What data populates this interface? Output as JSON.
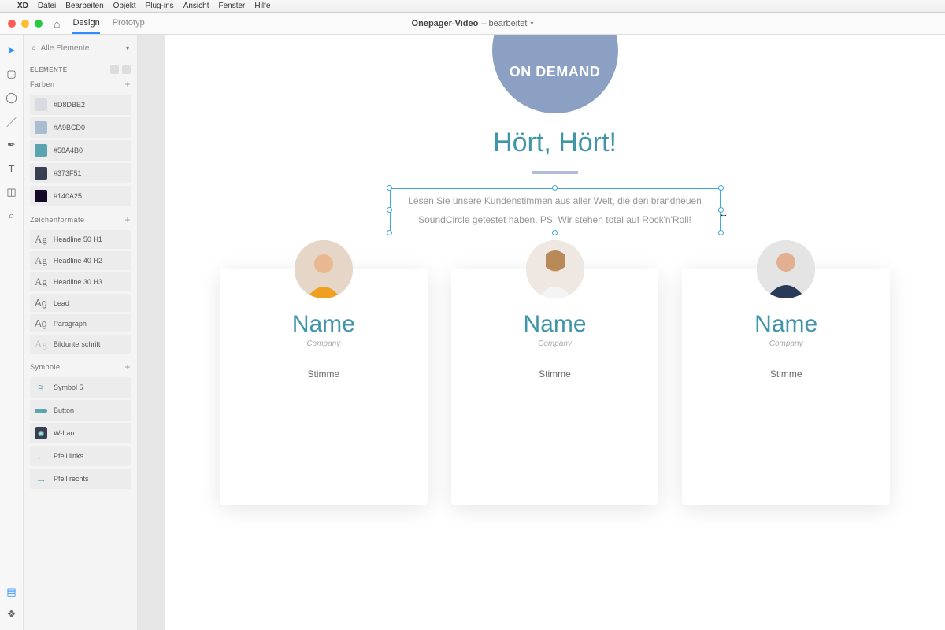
{
  "menubar": {
    "app": "XD",
    "items": [
      "Datei",
      "Bearbeiten",
      "Objekt",
      "Plug-ins",
      "Ansicht",
      "Fenster",
      "Hilfe"
    ]
  },
  "topbar": {
    "tabs": {
      "design": "Design",
      "prototype": "Prototyp"
    },
    "file_name": "Onepager-Video",
    "file_state": "– bearbeitet"
  },
  "assets": {
    "search_text": "Alle Elemente",
    "elements_label": "ELEMENTE",
    "colors_label": "Farben",
    "colors": [
      {
        "hex": "#D8DBE2",
        "label": "#D8DBE2"
      },
      {
        "hex": "#A9BCD0",
        "label": "#A9BCD0"
      },
      {
        "hex": "#58A4B0",
        "label": "#58A4B0"
      },
      {
        "hex": "#373F51",
        "label": "#373F51"
      },
      {
        "hex": "#140A25",
        "label": "#140A25"
      }
    ],
    "char_styles_label": "Zeichenformate",
    "char_styles": [
      {
        "label": "Headline 50 H1"
      },
      {
        "label": "Headline 40 H2"
      },
      {
        "label": "Headline 30 H3"
      },
      {
        "label": "Lead"
      },
      {
        "label": "Paragraph"
      },
      {
        "label": "Bildunterschrift",
        "muted": true
      }
    ],
    "symbols_label": "Symbole",
    "symbols": [
      {
        "label": "Symbol 5",
        "icon": "waves"
      },
      {
        "label": "Button",
        "icon": "button"
      },
      {
        "label": "W-Lan",
        "icon": "wifi"
      },
      {
        "label": "Pfeil links",
        "icon": "arrow-left"
      },
      {
        "label": "Pfeil rechts",
        "icon": "arrow-right"
      }
    ]
  },
  "canvas": {
    "badge_text": "ON DEMAND",
    "title": "Hört, Hört!",
    "subtitle": "Lesen Sie unsere Kundenstimmen aus aller Welt, die den brandneuen SoundCircle getestet haben. PS: Wir stehen total auf Rock'n'Roll!",
    "cards": [
      {
        "name": "Name",
        "company": "Company",
        "voice": "Stimme"
      },
      {
        "name": "Name",
        "company": "Company",
        "voice": "Stimme"
      },
      {
        "name": "Name",
        "company": "Company",
        "voice": "Stimme"
      }
    ]
  }
}
